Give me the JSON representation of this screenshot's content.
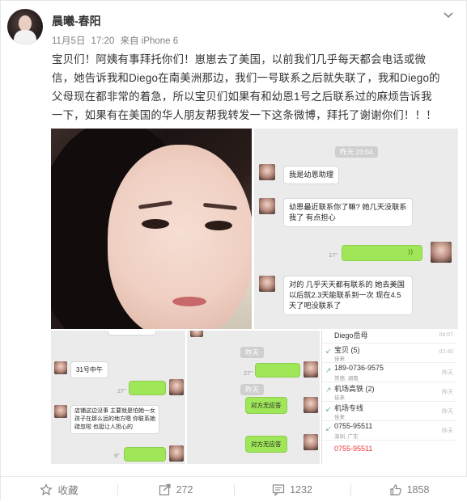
{
  "user": {
    "name": "晨曦-春阳"
  },
  "meta": {
    "date": "11月5日",
    "time": "17:20",
    "source": "来自 iPhone 6"
  },
  "post": {
    "text": "宝贝们！阿姨有事拜托你们！崽崽去了美国，以前我们几乎每天都会电话或微信，她告诉我和Diego在南美洲那边，我们一号联系之后就失联了，我和Diego的父母现在都非常的着急，所以宝贝们如果有和幼恩1号之后联系过的麻烦告诉我一下，如果有在美国的华人朋友帮我转发一下这条微博，拜托了谢谢你们！！！"
  },
  "chat1": {
    "time": "昨天 23:04",
    "msg1": "我是幼恩助理",
    "msg2": "幼恩最近联系你了嘛? 她几天没联系我了 有点担心",
    "voice_duration": "17\"",
    "msg3": "对的 几乎天天都有联系的 她去美国以后就2.3天能联系到一次 现在4.5天了吧没联系了"
  },
  "chat2": {
    "msg1": "31号中午",
    "dur1": "27\"",
    "msg2": "店铺这边没事 主要就是怕她一女孩子在那么远的地方嗯 你联系她疏忽啦 也挺让人担心的",
    "dur2": "9\""
  },
  "chat3": {
    "time1": "昨天",
    "dur1": "27\"",
    "time2": "昨天",
    "call1": "对方无应答",
    "call2": "对方无应答"
  },
  "contacts": [
    {
      "name": "Diego岳母",
      "sub": "",
      "time": "04:07",
      "red": false
    },
    {
      "name": "宝贝 (5)",
      "sub": "佳来",
      "time": "02:40",
      "red": false
    },
    {
      "name": "189-0736-9575",
      "sub": "常德, 湖南",
      "time": "昨天",
      "red": false
    },
    {
      "name": "机场高铁 (2)",
      "sub": "佳来",
      "time": "昨天",
      "red": false
    },
    {
      "name": "机场专线",
      "sub": "佳来",
      "time": "昨天",
      "red": false
    },
    {
      "name": "0755-95511",
      "sub": "深圳, 广东",
      "time": "昨天",
      "red": false
    },
    {
      "name": "0755-95511",
      "sub": "",
      "time": "",
      "red": true
    }
  ],
  "footer": {
    "favorite": "收藏",
    "repost": "272",
    "comment": "1232",
    "like": "1858"
  },
  "icons": {
    "chevron": "chevron-down-icon",
    "favorite": "star-outline-icon",
    "repost": "repost-icon",
    "comment": "comment-icon",
    "like": "thumbs-up-icon"
  },
  "colors": {
    "accent_green": "#9fe659",
    "chat_bg": "#ebebeb",
    "text": "#333333",
    "muted": "#808080"
  }
}
